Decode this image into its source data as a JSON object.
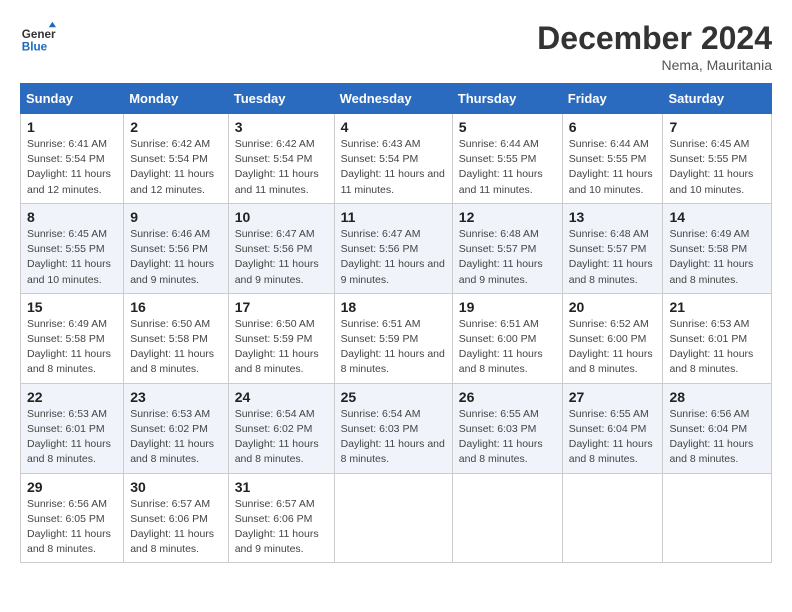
{
  "header": {
    "logo_line1": "General",
    "logo_line2": "Blue",
    "month": "December 2024",
    "location": "Nema, Mauritania"
  },
  "weekdays": [
    "Sunday",
    "Monday",
    "Tuesday",
    "Wednesday",
    "Thursday",
    "Friday",
    "Saturday"
  ],
  "weeks": [
    [
      {
        "day": "1",
        "sunrise": "6:41 AM",
        "sunset": "5:54 PM",
        "daylight": "11 hours and 12 minutes."
      },
      {
        "day": "2",
        "sunrise": "6:42 AM",
        "sunset": "5:54 PM",
        "daylight": "11 hours and 12 minutes."
      },
      {
        "day": "3",
        "sunrise": "6:42 AM",
        "sunset": "5:54 PM",
        "daylight": "11 hours and 11 minutes."
      },
      {
        "day": "4",
        "sunrise": "6:43 AM",
        "sunset": "5:54 PM",
        "daylight": "11 hours and 11 minutes."
      },
      {
        "day": "5",
        "sunrise": "6:44 AM",
        "sunset": "5:55 PM",
        "daylight": "11 hours and 11 minutes."
      },
      {
        "day": "6",
        "sunrise": "6:44 AM",
        "sunset": "5:55 PM",
        "daylight": "11 hours and 10 minutes."
      },
      {
        "day": "7",
        "sunrise": "6:45 AM",
        "sunset": "5:55 PM",
        "daylight": "11 hours and 10 minutes."
      }
    ],
    [
      {
        "day": "8",
        "sunrise": "6:45 AM",
        "sunset": "5:55 PM",
        "daylight": "11 hours and 10 minutes."
      },
      {
        "day": "9",
        "sunrise": "6:46 AM",
        "sunset": "5:56 PM",
        "daylight": "11 hours and 9 minutes."
      },
      {
        "day": "10",
        "sunrise": "6:47 AM",
        "sunset": "5:56 PM",
        "daylight": "11 hours and 9 minutes."
      },
      {
        "day": "11",
        "sunrise": "6:47 AM",
        "sunset": "5:56 PM",
        "daylight": "11 hours and 9 minutes."
      },
      {
        "day": "12",
        "sunrise": "6:48 AM",
        "sunset": "5:57 PM",
        "daylight": "11 hours and 9 minutes."
      },
      {
        "day": "13",
        "sunrise": "6:48 AM",
        "sunset": "5:57 PM",
        "daylight": "11 hours and 8 minutes."
      },
      {
        "day": "14",
        "sunrise": "6:49 AM",
        "sunset": "5:58 PM",
        "daylight": "11 hours and 8 minutes."
      }
    ],
    [
      {
        "day": "15",
        "sunrise": "6:49 AM",
        "sunset": "5:58 PM",
        "daylight": "11 hours and 8 minutes."
      },
      {
        "day": "16",
        "sunrise": "6:50 AM",
        "sunset": "5:58 PM",
        "daylight": "11 hours and 8 minutes."
      },
      {
        "day": "17",
        "sunrise": "6:50 AM",
        "sunset": "5:59 PM",
        "daylight": "11 hours and 8 minutes."
      },
      {
        "day": "18",
        "sunrise": "6:51 AM",
        "sunset": "5:59 PM",
        "daylight": "11 hours and 8 minutes."
      },
      {
        "day": "19",
        "sunrise": "6:51 AM",
        "sunset": "6:00 PM",
        "daylight": "11 hours and 8 minutes."
      },
      {
        "day": "20",
        "sunrise": "6:52 AM",
        "sunset": "6:00 PM",
        "daylight": "11 hours and 8 minutes."
      },
      {
        "day": "21",
        "sunrise": "6:53 AM",
        "sunset": "6:01 PM",
        "daylight": "11 hours and 8 minutes."
      }
    ],
    [
      {
        "day": "22",
        "sunrise": "6:53 AM",
        "sunset": "6:01 PM",
        "daylight": "11 hours and 8 minutes."
      },
      {
        "day": "23",
        "sunrise": "6:53 AM",
        "sunset": "6:02 PM",
        "daylight": "11 hours and 8 minutes."
      },
      {
        "day": "24",
        "sunrise": "6:54 AM",
        "sunset": "6:02 PM",
        "daylight": "11 hours and 8 minutes."
      },
      {
        "day": "25",
        "sunrise": "6:54 AM",
        "sunset": "6:03 PM",
        "daylight": "11 hours and 8 minutes."
      },
      {
        "day": "26",
        "sunrise": "6:55 AM",
        "sunset": "6:03 PM",
        "daylight": "11 hours and 8 minutes."
      },
      {
        "day": "27",
        "sunrise": "6:55 AM",
        "sunset": "6:04 PM",
        "daylight": "11 hours and 8 minutes."
      },
      {
        "day": "28",
        "sunrise": "6:56 AM",
        "sunset": "6:04 PM",
        "daylight": "11 hours and 8 minutes."
      }
    ],
    [
      {
        "day": "29",
        "sunrise": "6:56 AM",
        "sunset": "6:05 PM",
        "daylight": "11 hours and 8 minutes."
      },
      {
        "day": "30",
        "sunrise": "6:57 AM",
        "sunset": "6:06 PM",
        "daylight": "11 hours and 8 minutes."
      },
      {
        "day": "31",
        "sunrise": "6:57 AM",
        "sunset": "6:06 PM",
        "daylight": "11 hours and 9 minutes."
      },
      null,
      null,
      null,
      null
    ]
  ]
}
